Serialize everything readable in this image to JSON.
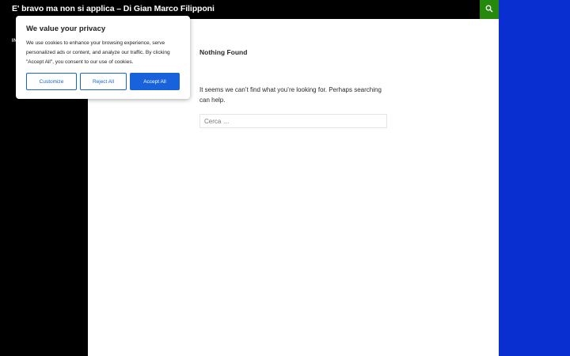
{
  "header": {
    "site_title": "E' bravo ma non si applica – Di Gian Marco Filipponi",
    "search_icon": "search-icon"
  },
  "sidebar": {
    "label": "IN"
  },
  "content": {
    "title": "Nothing Found",
    "message": "It seems we can’t find what you’re looking for. Perhaps searching can help.",
    "search_placeholder": "Cerca …"
  },
  "cookie_banner": {
    "title": "We value your privacy",
    "text": "We use cookies to enhance your browsing experience, serve personalized ads or content, and analyze our traffic. By clicking \"Accept All\", you consent to our use of cookies.",
    "customize_label": "Customize",
    "reject_label": "Reject All",
    "accept_label": "Accept All"
  },
  "colors": {
    "background": "#0a2fd0",
    "header": "#000000",
    "search_accent": "#24890d",
    "cookie_button": "#1863dc"
  }
}
